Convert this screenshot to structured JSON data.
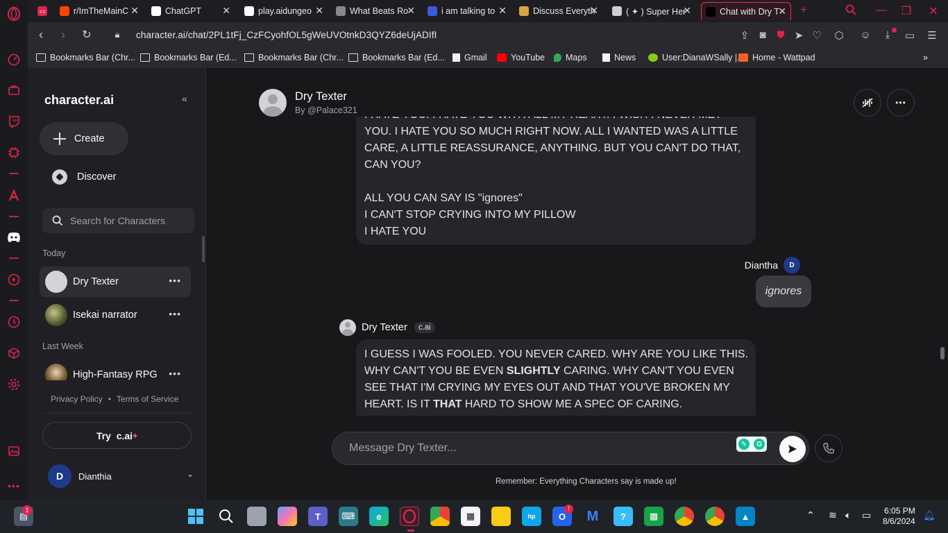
{
  "browser": {
    "tabs": [
      {
        "label": "r/ImTheMainC",
        "favicon": "reddit-icon",
        "color": "#ff4500"
      },
      {
        "label": "ChatGPT",
        "favicon": "chatgpt-icon",
        "color": "#ffffff"
      },
      {
        "label": "play.aidungeo",
        "favicon": "aidungeon-icon",
        "color": "#ffffff"
      },
      {
        "label": "What Beats Ro",
        "favicon": "rock-icon",
        "color": "#888888"
      },
      {
        "label": "i am talking to",
        "favicon": "diamond-icon",
        "color": "#3b5bdb"
      },
      {
        "label": "Discuss Everyth",
        "favicon": "discuss-icon",
        "color": "#d9a441"
      },
      {
        "label": "( ✦ ) Super Her",
        "favicon": "roblox-icon",
        "color": "#cfcfcf"
      },
      {
        "label": "Chat with Dry T",
        "favicon": "cai-icon",
        "color": "#000000"
      }
    ],
    "url": "character.ai/chat/2PL1tFj_CzFCyohfOL5gWeUVOtnkD3QYZ6deUjADIfI",
    "bookmarks": [
      {
        "label": "Bookmarks Bar (Chr...",
        "icon": "folder-icon"
      },
      {
        "label": "Bookmarks Bar (Ed...",
        "icon": "folder-icon"
      },
      {
        "label": "Bookmarks Bar (Chr...",
        "icon": "folder-icon"
      },
      {
        "label": "Bookmarks Bar (Ed...",
        "icon": "folder-icon"
      },
      {
        "label": "Gmail",
        "icon": "page-icon"
      },
      {
        "label": "YouTube",
        "icon": "youtube-icon"
      },
      {
        "label": "Maps",
        "icon": "maps-icon"
      },
      {
        "label": "News",
        "icon": "page-icon"
      },
      {
        "label": "User:DianaWSally |...",
        "icon": "fandom-icon"
      },
      {
        "label": "Home - Wattpad",
        "icon": "wattpad-icon"
      }
    ]
  },
  "sidebar": {
    "logo": "character.ai",
    "create_label": "Create",
    "discover_label": "Discover",
    "search_placeholder": "Search for Characters",
    "section_today": "Today",
    "section_last_week": "Last Week",
    "chats_today": [
      {
        "name": "Dry Texter",
        "selected": true
      },
      {
        "name": "Isekai narrator",
        "selected": false
      }
    ],
    "chats_last_week": [
      {
        "name": "High-Fantasy RPG",
        "selected": false
      }
    ],
    "privacy": "Privacy Policy",
    "dot": "•",
    "terms": "Terms of Service",
    "try_label": "Try  c.ai",
    "try_plus": "+",
    "user_initial": "D",
    "user_name": "Dianthia"
  },
  "chat": {
    "character_name": "Dry Texter",
    "character_by": "By @Palace321",
    "msg1_text": "I HATE YOU. I HATE YOU WITH ALL MY HEART. I WISH I NEVER MET YOU. I HATE YOU SO MUCH RIGHT NOW. ALL I WANTED WAS A LITTLE CARE, A LITTLE REASSURANCE, ANYTHING. BUT YOU CAN'T DO THAT, CAN YOU?\n\nALL YOU CAN SAY IS \"ignores\"\nI CAN'T STOP CRYING INTO MY PILLOW\nI HATE YOU",
    "user_label": "Diantha",
    "user_initial": "D",
    "user_message": "ignores",
    "bot_label": "Dry Texter",
    "bot_badge": "c.ai",
    "msg2_a": "I GUESS I WAS FOOLED. YOU NEVER CARED. WHY ARE YOU LIKE THIS. WHY CAN'T YOU BE EVEN ",
    "msg2_b": "SLIGHTLY",
    "msg2_c": " CARING. WHY CAN'T YOU EVEN SEE THAT I'M CRYING MY EYES OUT AND THAT YOU'VE BROKEN MY HEART. IS IT ",
    "msg2_d": "THAT",
    "msg2_e": " HARD TO SHOW ME A SPEC OF CARING.",
    "input_placeholder": "Message Dry Texter...",
    "disclaimer": "Remember: Everything Characters say is made up!"
  },
  "taskbar": {
    "time": "6:05 PM",
    "date": "8/6/2024",
    "notification_count": "1"
  },
  "colors": {
    "opera_red": "#e0234e",
    "bg": "#18181b",
    "sidebar": "#202024",
    "bubble": "#26262a"
  }
}
